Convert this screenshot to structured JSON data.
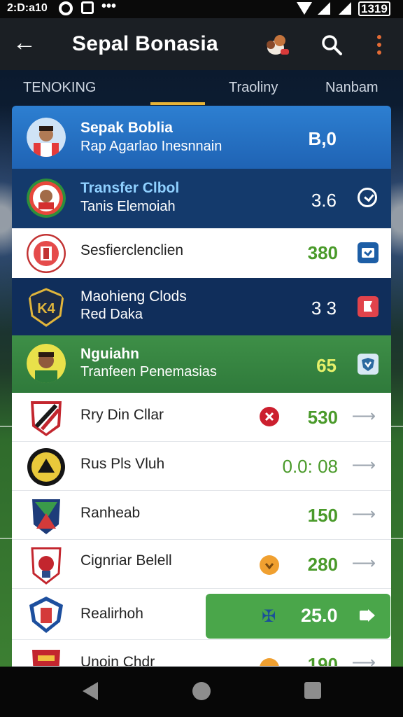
{
  "status_bar": {
    "time": "2:D:a10",
    "battery": "1319"
  },
  "header": {
    "title": "Sepal Bonasia"
  },
  "tabs": [
    "TENOKING",
    "Traoliny",
    "Nanbam"
  ],
  "rows": [
    {
      "name": "Sepak Boblia",
      "sub": "Rap Agarlao Inesnnain",
      "value": "B,0"
    },
    {
      "name": "Transfer Clbol",
      "sub": "Tanis Elemoiah",
      "value": "3.6"
    },
    {
      "name": "Sesfierclenclien",
      "value": "380"
    },
    {
      "name": "Maohieng Clods",
      "sub": "Red Daka",
      "value": "3 3"
    },
    {
      "name": "Nguiahn",
      "sub": "Tranfeen Penemasias",
      "value": "65"
    },
    {
      "name": "Rry Din Cllar",
      "value": "530"
    },
    {
      "name": "Rus Pls Vluh",
      "value": "0.0: 08"
    },
    {
      "name": "Ranheab",
      "value": "150"
    },
    {
      "name": "Cignriar Belell",
      "value": "280"
    },
    {
      "name": "Realirhoh",
      "value": "25.0"
    },
    {
      "name": "Unoin Chdr",
      "value": "190"
    }
  ],
  "colors": {
    "header_bg": "#1b1f24",
    "accent_tab": "#e8b437",
    "highlight_green": "#4aa64a",
    "value_green": "#4a9a2a"
  }
}
